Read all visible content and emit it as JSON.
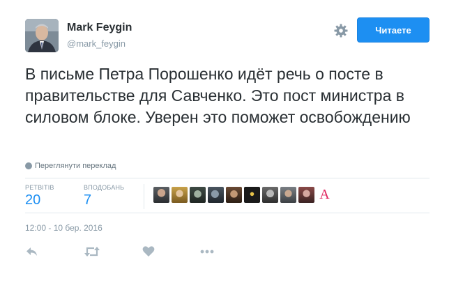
{
  "author": {
    "name": "Mark Feygin",
    "handle": "@mark_feygin"
  },
  "header": {
    "settings_icon": "gear-icon",
    "follow_label": "Читаете"
  },
  "tweet": {
    "text": "В письме Петра Порошенко идёт речь о посте в правительстве для Савченко. Это пост министра в силовом блоке. Уверен это поможет освобождению",
    "translate_label": "Переглянути переклад",
    "timestamp": "12:00 - 10 бер. 2016"
  },
  "stats": {
    "retweets_label": "РЕТВІТІВ",
    "retweets_value": "20",
    "likes_label": "ВПОДОБАНЬ",
    "likes_value": "7"
  },
  "likers": {
    "letter_avatar": "A"
  },
  "actions": [
    "reply-icon",
    "retweet-icon",
    "like-icon",
    "more-icon"
  ],
  "colors": {
    "accent": "#1d8ff2",
    "text": "#292f33",
    "muted": "#8899a6",
    "divider": "#e1e8ed"
  }
}
